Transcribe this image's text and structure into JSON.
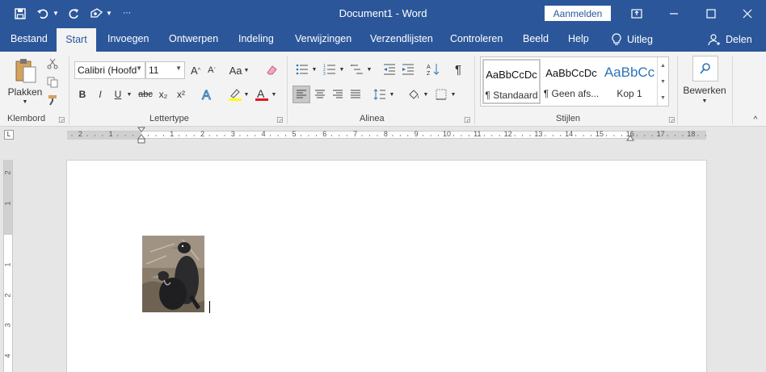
{
  "titlebar": {
    "document_title": "Document1  -  Word",
    "signin_label": "Aanmelden"
  },
  "tabs": [
    "Bestand",
    "Start",
    "Invoegen",
    "Ontwerpen",
    "Indeling",
    "Verwijzingen",
    "Verzendlijsten",
    "Controleren",
    "Beeld",
    "Help"
  ],
  "tell_me": "Uitleg",
  "share": "Delen",
  "clipboard": {
    "paste_label": "Plakken",
    "group_label": "Klembord"
  },
  "font": {
    "name": "Calibri (Hoofd",
    "size": "11",
    "group_label": "Lettertype",
    "case_label": "Aa",
    "bold": "B",
    "italic": "I",
    "underline": "U",
    "strike": "abc",
    "sub": "x₂",
    "sup": "x²"
  },
  "paragraph": {
    "group_label": "Alinea"
  },
  "styles": {
    "group_label": "Stijlen",
    "items": [
      {
        "sample": "AaBbCcDc",
        "name": "¶ Standaard"
      },
      {
        "sample": "AaBbCcDc",
        "name": "¶ Geen afs..."
      },
      {
        "sample": "AaBbCc",
        "name": "Kop 1"
      }
    ]
  },
  "editing": {
    "label": "Bewerken"
  },
  "ruler": {
    "numbers": [
      "2",
      "1",
      "1",
      "2",
      "3",
      "4",
      "5",
      "6",
      "7",
      "8",
      "9",
      "10",
      "11",
      "12",
      "13",
      "14",
      "15",
      "16",
      "17",
      "18"
    ],
    "vertical_numbers": [
      "2",
      "1",
      "1",
      "2",
      "3",
      "4"
    ]
  },
  "colors": {
    "accent": "#2b579a",
    "font_color": "#e81123"
  }
}
